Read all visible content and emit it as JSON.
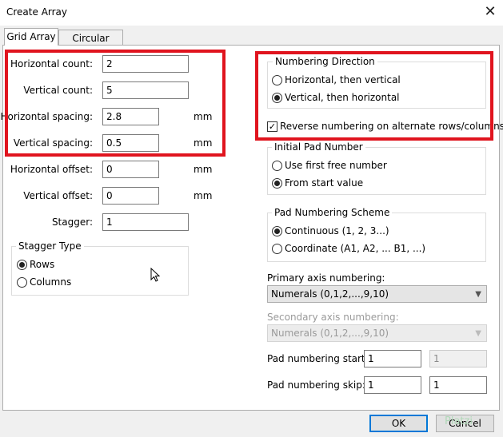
{
  "window": {
    "title": "Create Array",
    "close_symbol": "✕"
  },
  "tabs": [
    {
      "label": "Grid Array",
      "active": true
    },
    {
      "label": "Circular Array",
      "active": false
    }
  ],
  "grid": {
    "horizontal_count": {
      "label": "Horizontal count:",
      "value": "2"
    },
    "vertical_count": {
      "label": "Vertical count:",
      "value": "5"
    },
    "horizontal_spacing": {
      "label": "Horizontal spacing:",
      "value": "2.8",
      "unit": "mm"
    },
    "vertical_spacing": {
      "label": "Vertical spacing:",
      "value": "0.5",
      "unit": "mm"
    },
    "horizontal_offset": {
      "label": "Horizontal offset:",
      "value": "0",
      "unit": "mm"
    },
    "vertical_offset": {
      "label": "Vertical offset:",
      "value": "0",
      "unit": "mm"
    },
    "stagger": {
      "label": "Stagger:",
      "value": "1"
    }
  },
  "stagger_type": {
    "title": "Stagger Type",
    "options": [
      {
        "label": "Rows",
        "selected": true
      },
      {
        "label": "Columns",
        "selected": false
      }
    ]
  },
  "numbering_direction": {
    "title": "Numbering Direction",
    "options": [
      {
        "label": "Horizontal, then vertical",
        "selected": false
      },
      {
        "label": "Vertical, then horizontal",
        "selected": true
      }
    ]
  },
  "reverse_numbering": {
    "label": "Reverse numbering on alternate rows/columns",
    "checked": true
  },
  "initial_pad_number": {
    "title": "Initial Pad Number",
    "options": [
      {
        "label": "Use first free number",
        "selected": false
      },
      {
        "label": "From start value",
        "selected": true
      }
    ]
  },
  "pad_numbering_scheme": {
    "title": "Pad Numbering Scheme",
    "options": [
      {
        "label": "Continuous (1, 2, 3...)",
        "selected": true
      },
      {
        "label": "Coordinate (A1, A2, ... B1, ...)",
        "selected": false
      }
    ]
  },
  "primary_axis": {
    "label": "Primary axis numbering:",
    "value": "Numerals (0,1,2,...,9,10)"
  },
  "secondary_axis": {
    "label": "Secondary axis numbering:",
    "value": "Numerals (0,1,2,...,9,10)",
    "enabled": false
  },
  "pad_numbering_start": {
    "label": "Pad numbering start:",
    "value1": "1",
    "value2": "1"
  },
  "pad_numbering_skip": {
    "label": "Pad numbering skip:",
    "value1": "1",
    "value2": "1"
  },
  "buttons": {
    "ok": "OK",
    "cancel": "Cancel"
  },
  "watermark": "Platzi",
  "colors": {
    "highlight": "#e0141e",
    "focus": "#0078d7"
  }
}
